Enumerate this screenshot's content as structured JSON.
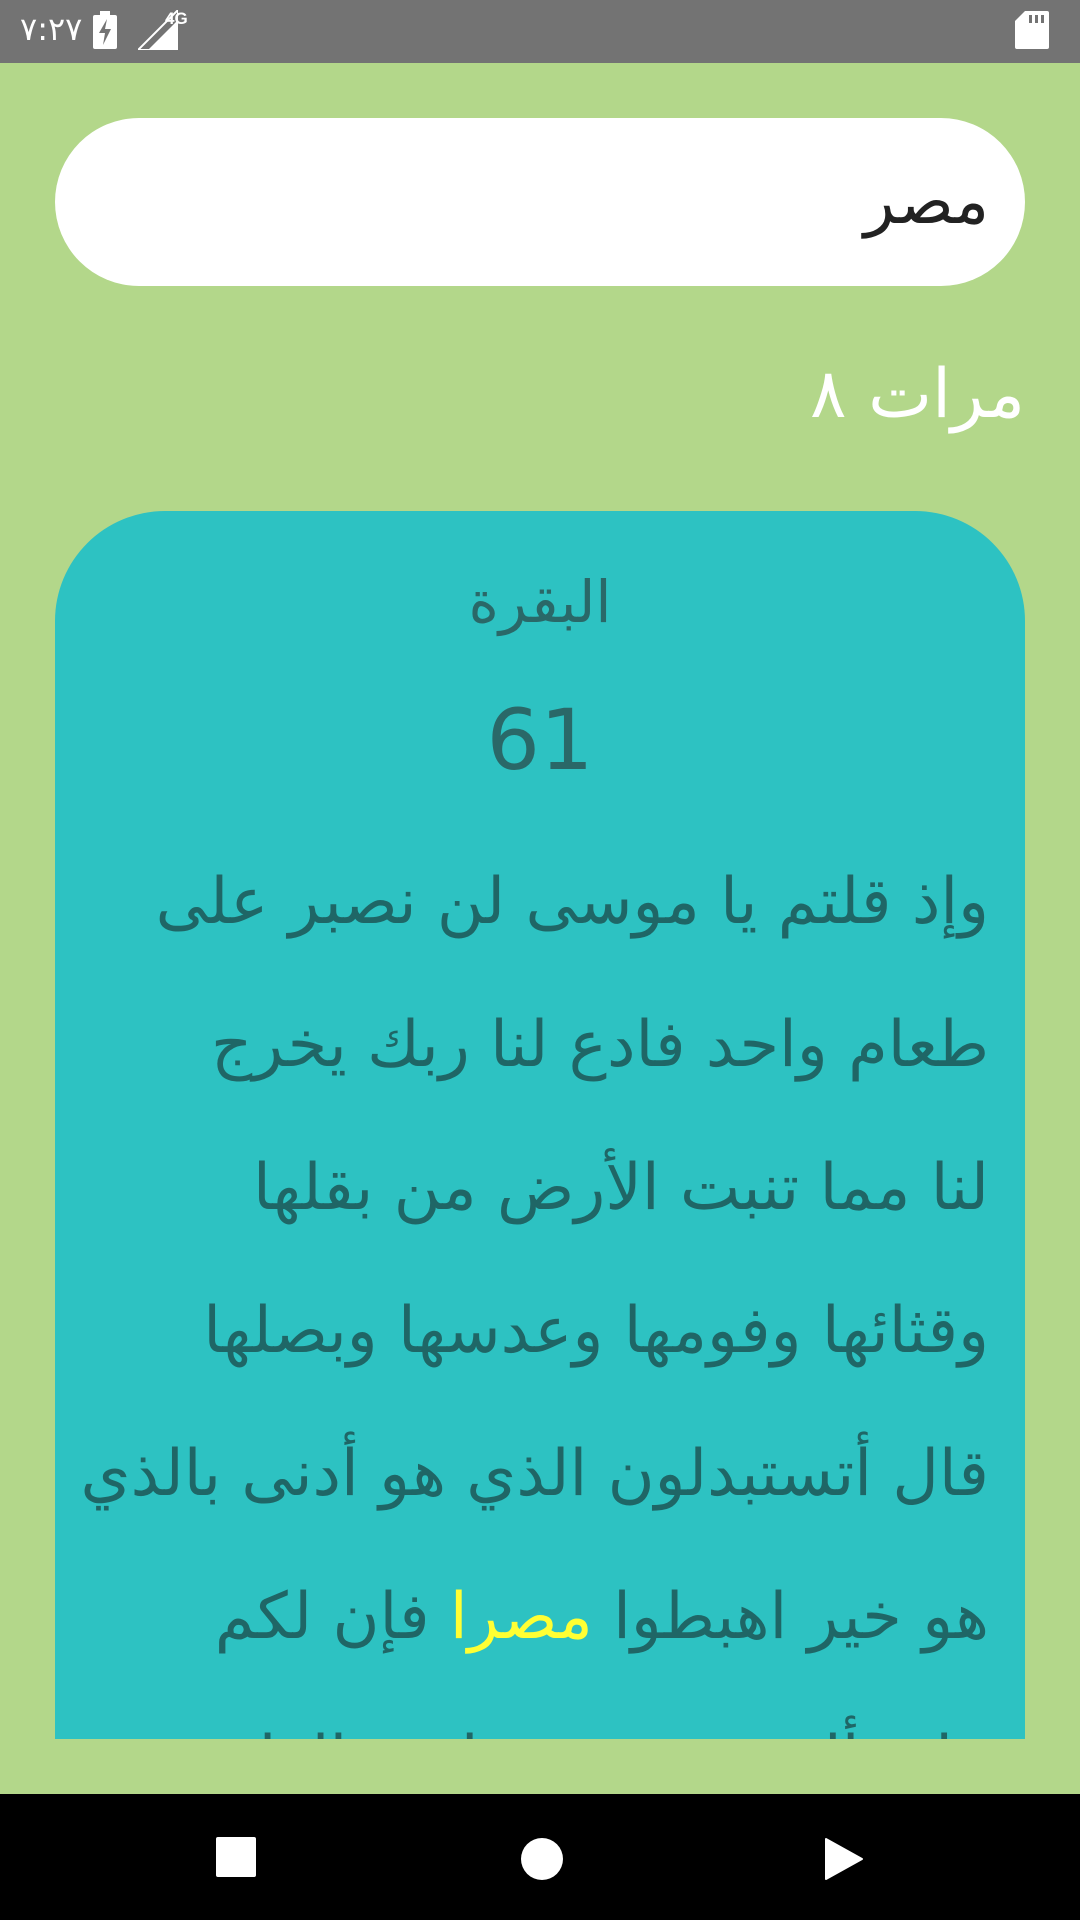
{
  "status_bar": {
    "time": "٧:٢٧",
    "network_label": "4G",
    "icons": [
      "battery-charging-icon",
      "signal-icon",
      "sd-card-icon"
    ]
  },
  "search": {
    "value": "مصر",
    "placeholder": ""
  },
  "result_count": {
    "label": "مرات ٨"
  },
  "result": {
    "surah": "البقرة",
    "ayah_number": "61",
    "lines": [
      {
        "text": "وإذ قلتم يا موسى لن نصبر على"
      },
      {
        "text": "طعام واحد فادع لنا ربك يخرج"
      },
      {
        "text": "لنا مما تنبت الأرض من بقلها"
      },
      {
        "text": "وقثائها وفومها وعدسها وبصلها"
      },
      {
        "text": "قال أتستبدلون الذي هو أدنى بالذي"
      },
      {
        "before": "هو خير اهبطوا ",
        "match": "مصرا",
        "after": " فإن لكم"
      },
      {
        "text": "ما سألتم وضربت عليهم الذلة"
      }
    ]
  },
  "colors": {
    "background": "#b3d78a",
    "card": "#2dc2c2",
    "card_text": "#1f6666",
    "highlight": "#ffff33",
    "status_bar": "#737373",
    "nav_bar": "#000000"
  },
  "nav": {
    "buttons": [
      "recents-icon",
      "home-icon",
      "back-icon"
    ]
  }
}
